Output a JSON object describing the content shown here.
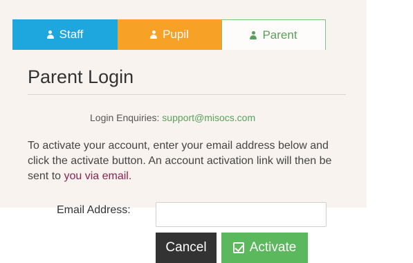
{
  "tabs": [
    {
      "label": "Staff",
      "icon": "user-icon",
      "color": "#1ea7df"
    },
    {
      "label": "Pupil",
      "icon": "user-icon",
      "color": "#f7a126"
    },
    {
      "label": "Parent",
      "icon": "user-icon",
      "color": "#5aa05a",
      "active": true
    }
  ],
  "page": {
    "title": "Parent Login",
    "enquiries_label": "Login Enquiries:",
    "enquiries_email": "support@misocs.com",
    "instructions_part1": "To activate your account, enter your email address below and click the activate button. An account activation link will then be sent to",
    "instructions_part2": "you via email."
  },
  "form": {
    "email_label": "Email Address:",
    "email_value": "",
    "email_placeholder": ""
  },
  "buttons": {
    "cancel_label": "Cancel",
    "activate_label": "Activate",
    "activate_icon": "check-square-icon"
  },
  "colors": {
    "panel_bg": "#f8f3ef",
    "accent_green": "#5cb85c",
    "cancel_bg": "#333333"
  }
}
